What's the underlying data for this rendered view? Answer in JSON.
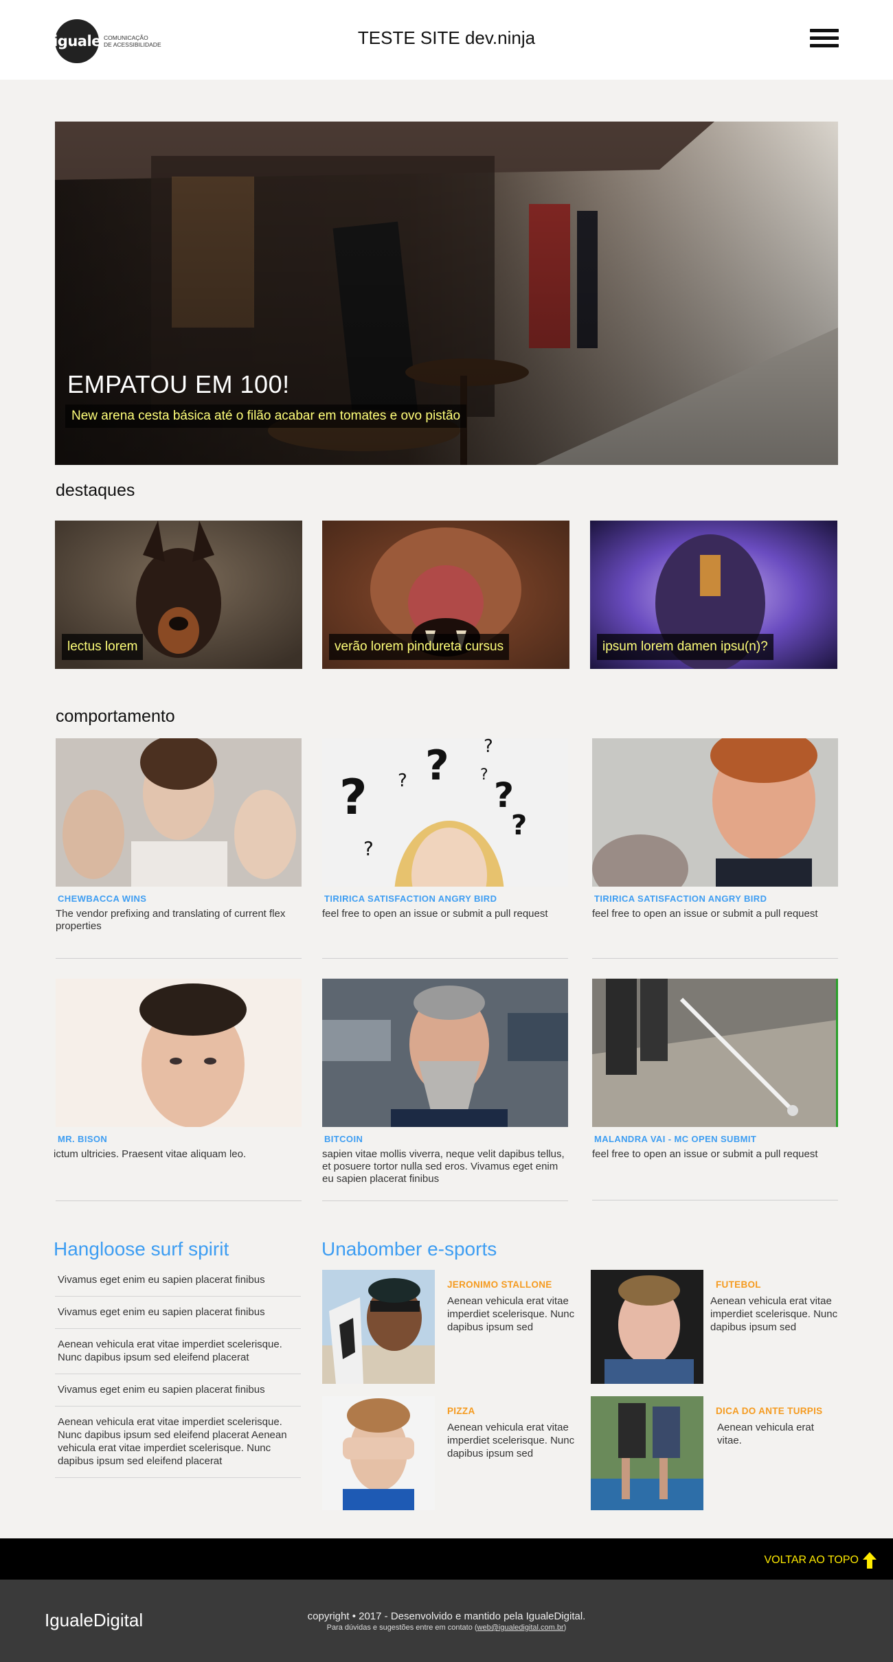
{
  "header": {
    "logo_mark": "iguale",
    "logo_tagline_1": "COMUNICAÇÃO",
    "logo_tagline_2": "DE ACESSIBILIDADE",
    "title_main": "TESTE SITE ",
    "title_light": "dev.ninja",
    "menu_icon": "hamburger-icon"
  },
  "hero": {
    "title": "EMPATOU EM 100!",
    "subtitle": "New arena cesta básica até o filão acabar em tomates e ovo pistão"
  },
  "destaques": {
    "title": "destaques",
    "cards": [
      {
        "label": "lectus lorem"
      },
      {
        "label": "verão lorem pindureta cursus"
      },
      {
        "label": "ipsum lorem damen ipsu(n)?"
      }
    ]
  },
  "comportamento": {
    "title": "comportamento",
    "cards": [
      {
        "tag": "CHEWBACCA WINS",
        "text": "The vendor prefixing and translating of current flex properties"
      },
      {
        "tag": "TIRIRICA SATISFACTION ANGRY BIRD",
        "text": "feel free to open an issue or submit a pull request"
      },
      {
        "tag": "TIRIRICA SATISFACTION ANGRY BIRD",
        "text": "feel free to open an issue or submit a pull request"
      },
      {
        "tag": "MR. BISON",
        "text": "ictum ultricies. Praesent vitae aliquam leo."
      },
      {
        "tag": "BITCOIN",
        "text": "sapien vitae mollis viverra, neque velit dapibus tellus, et posuere tortor nulla sed eros. Vivamus eget enim eu sapien placerat finibus"
      },
      {
        "tag": "MALANDRA VAI - MC OPEN SUBMIT",
        "text": "feel free to open an issue or submit a pull request"
      }
    ]
  },
  "hangloose": {
    "title": "Hangloose surf spirit",
    "items": [
      "Vivamus eget enim eu sapien placerat finibus",
      "Vivamus eget enim eu sapien placerat finibus",
      "Aenean vehicula erat vitae imperdiet scelerisque. Nunc dapibus ipsum sed eleifend placerat",
      "Vivamus eget enim eu sapien placerat finibus",
      "Aenean vehicula erat vitae imperdiet scelerisque. Nunc dapibus ipsum sed eleifend placerat Aenean vehicula erat vitae imperdiet scelerisque. Nunc dapibus ipsum sed eleifend placerat"
    ]
  },
  "unabomber": {
    "title": "Unabomber e-sports",
    "cards": [
      {
        "tag": "JERONIMO STALLONE",
        "text": "Aenean vehicula erat vitae imperdiet scelerisque. Nunc dapibus ipsum sed"
      },
      {
        "tag": "FUTEBOL",
        "text": "Aenean vehicula erat vitae imperdiet scelerisque. Nunc dapibus ipsum sed"
      },
      {
        "tag": "PIZZA",
        "text": "Aenean vehicula erat vitae imperdiet scelerisque. Nunc dapibus ipsum sed"
      },
      {
        "tag": "DICA DO ANTE TURPIS",
        "text": "Aenean vehicula erat vitae."
      }
    ]
  },
  "footer": {
    "back_to_top": "VOLTAR AO TOPO",
    "brand": "IgualeDigital",
    "copyright": "copyright • 2017 - Desenvolvido e mantido pela IgualeDigital.",
    "contact_prefix": "Para dúvidas e sugestões entre em contato (",
    "contact_email": "web@igualedigital.com.br",
    "contact_suffix": ")"
  },
  "colors": {
    "accent_blue": "#3d9df2",
    "accent_orange": "#f59a1e",
    "highlight_yellow": "#ffff7a",
    "back_to_top_yellow": "#ffeb00"
  }
}
